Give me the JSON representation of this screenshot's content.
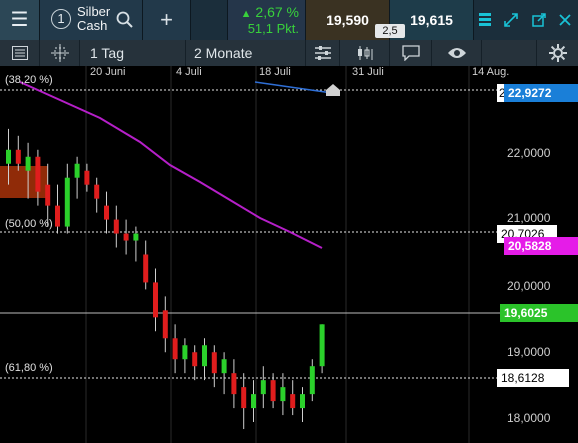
{
  "header": {
    "menu_icon": "hamburger-icon",
    "instrument_number": "1",
    "instrument_name": "Silber",
    "instrument_sub": "Cash",
    "change_pct": "2,67 %",
    "change_pts": "51,1 Pkt.",
    "sell_price": "19,590",
    "buy_price": "19,615",
    "spread": "2,5",
    "colors": {
      "up": "#38d13b",
      "accent": "#19c2d6"
    }
  },
  "toolbar": {
    "interval": "1 Tag",
    "range": "2 Monate"
  },
  "axis": {
    "dates": [
      "20 Juni",
      "4 Juli",
      "18 Juli",
      "31 Juli",
      "14 Aug."
    ],
    "y_ticks": [
      "22,0000",
      "21,0000",
      "20,0000",
      "19,0000",
      "18,0000"
    ]
  },
  "levels": {
    "fib_382": "(38,20 %)",
    "fib_50": "(50,00 %)",
    "fib_618": "(61,80 %)",
    "tag_top_partial": "2",
    "tag_50_partial": "20,7026"
  },
  "tags": {
    "blue": "22,9272",
    "magenta": "20,5828",
    "green": "19,6025",
    "fib618": "18,6128"
  },
  "chart_data": {
    "type": "candlestick",
    "y_range": [
      17.9,
      23.3
    ],
    "candles": [
      {
        "o": 21.9,
        "h": 22.4,
        "l": 21.6,
        "c": 22.1
      },
      {
        "o": 22.1,
        "h": 22.3,
        "l": 21.8,
        "c": 21.9
      },
      {
        "o": 21.8,
        "h": 22.2,
        "l": 21.4,
        "c": 22.0
      },
      {
        "o": 22.0,
        "h": 22.1,
        "l": 21.3,
        "c": 21.5
      },
      {
        "o": 21.6,
        "h": 21.9,
        "l": 21.0,
        "c": 21.3
      },
      {
        "o": 21.3,
        "h": 21.6,
        "l": 20.9,
        "c": 21.0
      },
      {
        "o": 21.0,
        "h": 21.9,
        "l": 20.9,
        "c": 21.7
      },
      {
        "o": 21.7,
        "h": 22.0,
        "l": 21.4,
        "c": 21.9
      },
      {
        "o": 21.8,
        "h": 21.9,
        "l": 21.5,
        "c": 21.6
      },
      {
        "o": 21.6,
        "h": 21.7,
        "l": 21.2,
        "c": 21.4
      },
      {
        "o": 21.3,
        "h": 21.5,
        "l": 20.9,
        "c": 21.1
      },
      {
        "o": 21.1,
        "h": 21.3,
        "l": 20.7,
        "c": 20.9
      },
      {
        "o": 20.9,
        "h": 21.1,
        "l": 20.6,
        "c": 20.8
      },
      {
        "o": 20.8,
        "h": 21.0,
        "l": 20.5,
        "c": 20.9
      },
      {
        "o": 20.6,
        "h": 20.8,
        "l": 20.1,
        "c": 20.2
      },
      {
        "o": 20.2,
        "h": 20.4,
        "l": 19.5,
        "c": 19.7
      },
      {
        "o": 19.8,
        "h": 20.0,
        "l": 19.2,
        "c": 19.4
      },
      {
        "o": 19.4,
        "h": 19.6,
        "l": 18.9,
        "c": 19.1
      },
      {
        "o": 19.1,
        "h": 19.4,
        "l": 18.9,
        "c": 19.3
      },
      {
        "o": 19.2,
        "h": 19.3,
        "l": 18.8,
        "c": 19.0
      },
      {
        "o": 19.0,
        "h": 19.4,
        "l": 18.8,
        "c": 19.3
      },
      {
        "o": 19.2,
        "h": 19.3,
        "l": 18.7,
        "c": 18.9
      },
      {
        "o": 18.9,
        "h": 19.2,
        "l": 18.6,
        "c": 19.1
      },
      {
        "o": 18.9,
        "h": 19.1,
        "l": 18.4,
        "c": 18.6
      },
      {
        "o": 18.7,
        "h": 18.9,
        "l": 18.1,
        "c": 18.4
      },
      {
        "o": 18.4,
        "h": 18.8,
        "l": 18.2,
        "c": 18.6
      },
      {
        "o": 18.6,
        "h": 19.0,
        "l": 18.4,
        "c": 18.8
      },
      {
        "o": 18.8,
        "h": 18.9,
        "l": 18.4,
        "c": 18.5
      },
      {
        "o": 18.5,
        "h": 18.9,
        "l": 18.3,
        "c": 18.7
      },
      {
        "o": 18.6,
        "h": 18.8,
        "l": 18.3,
        "c": 18.4
      },
      {
        "o": 18.4,
        "h": 18.7,
        "l": 18.2,
        "c": 18.6
      },
      {
        "o": 18.6,
        "h": 19.1,
        "l": 18.5,
        "c": 19.0
      },
      {
        "o": 19.0,
        "h": 19.6,
        "l": 18.9,
        "c": 19.6
      }
    ]
  }
}
